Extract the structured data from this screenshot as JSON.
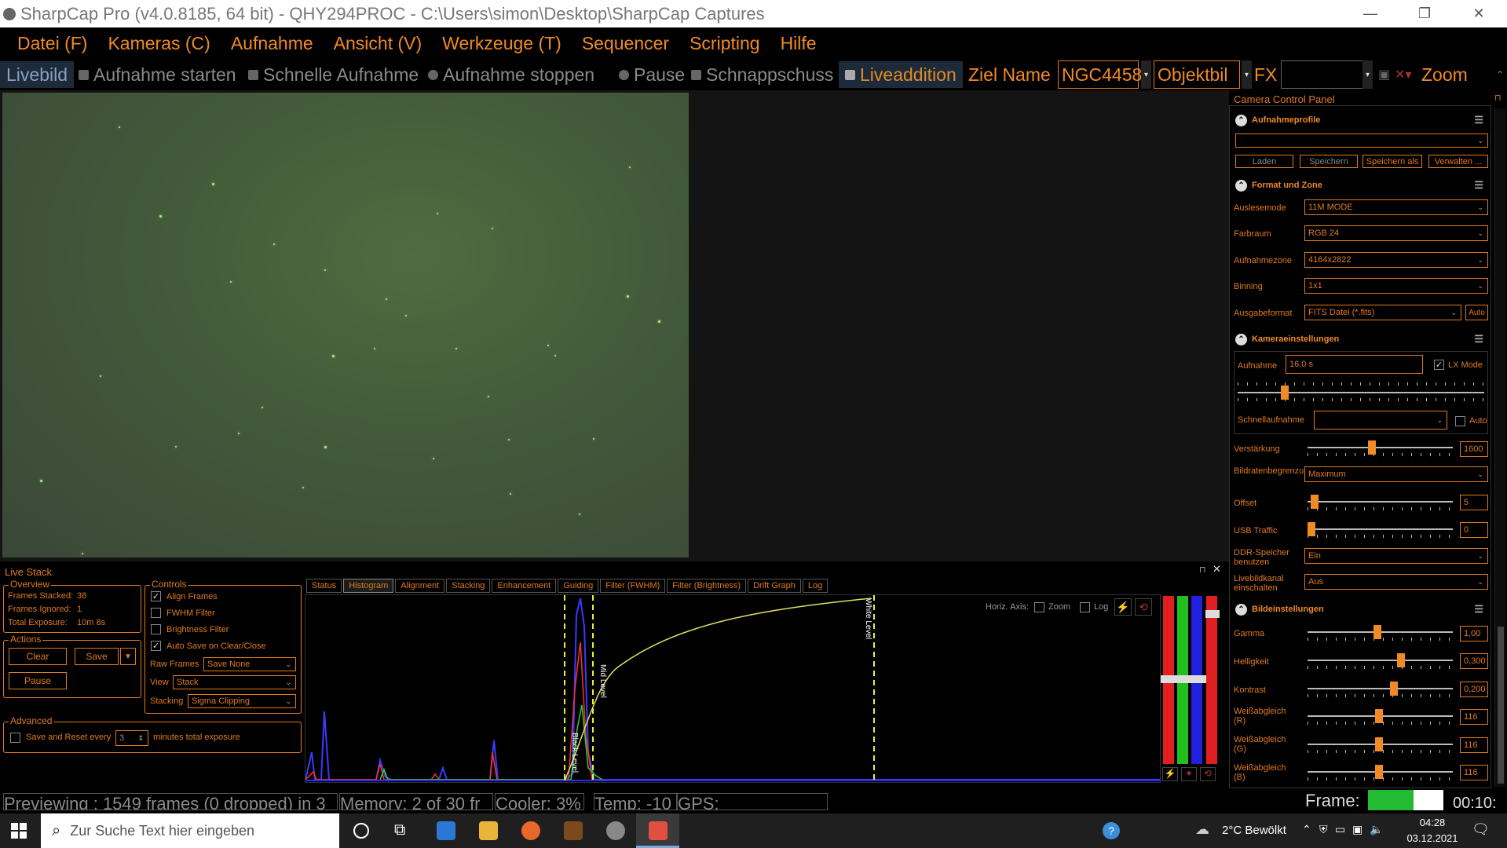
{
  "window": {
    "title": "SharpCap Pro (v4.0.8185, 64 bit) - QHY294PROC - C:\\Users\\simon\\Desktop\\SharpCap Captures",
    "minimize": "—",
    "restore": "❐",
    "close": "✕"
  },
  "menu": [
    "Datei (F)",
    "Kameras (C)",
    "Aufnahme",
    "Ansicht (V)",
    "Werkzeuge (T)",
    "Sequencer",
    "Scripting",
    "Hilfe"
  ],
  "toolbar": {
    "livebild": "Livebild",
    "start": "Aufnahme starten",
    "quick": "Schnelle Aufnahme",
    "stop": "Aufnahme stoppen",
    "pause": "Pause",
    "snapshot": "Schnappschuss",
    "livestack": "Liveaddition",
    "target_label": "Ziel Name",
    "target_value": "NGC4458",
    "object_type": "Objektbil",
    "fx": "FX",
    "zoom": "Zoom"
  },
  "livestack": {
    "title": "Live Stack",
    "overview_title": "Overview",
    "frames_stacked_label": "Frames Stacked:",
    "frames_stacked": "38",
    "frames_ignored_label": "Frames Ignored:",
    "frames_ignored": "1",
    "total_exposure_label": "Total Exposure:",
    "total_exposure": "10m 8s",
    "actions_title": "Actions",
    "clear": "Clear",
    "save": "Save",
    "pause": "Pause",
    "advanced_title": "Advanced",
    "save_reset": "Save and Reset every",
    "save_reset_value": "3",
    "save_reset_suffix": "minutes total exposure",
    "controls_title": "Controls",
    "align_frames": "Align Frames",
    "fwhm_filter": "FWHM Filter",
    "brightness_filter": "Brightness Filter",
    "auto_save": "Auto Save on Clear/Close",
    "raw_frames_label": "Raw Frames",
    "raw_frames": "Save None",
    "view_label": "View",
    "view": "Stack",
    "stacking_label": "Stacking",
    "stacking": "Sigma Clipping",
    "tabs": [
      "Status",
      "Histogram",
      "Alignment",
      "Stacking",
      "Enhancement",
      "Guiding",
      "Filter (FWHM)",
      "Filter (Brightness)",
      "Drift Graph",
      "Log"
    ],
    "horiz_axis": "Horiz. Axis:",
    "zoom": "Zoom",
    "log": "Log",
    "black_level": "Black Level",
    "mid_level": "Mid Level",
    "white_level": "White Level"
  },
  "ccp": {
    "title": "Camera Control Panel",
    "profiles_title": "Aufnahmeprofile",
    "profile_value": "",
    "load": "Laden",
    "save": "Speichern",
    "save_as": "Speichern als",
    "manage": "Verwalten ...",
    "format_title": "Format und Zone",
    "readmode_label": "Auslesemode",
    "readmode": "11M MODE",
    "colorspace_label": "Farbraum",
    "colorspace": "RGB 24",
    "roi_label": "Aufnahmezone",
    "roi": "4164x2822",
    "binning_label": "Binning",
    "binning": "1x1",
    "output_label": "Ausgabeformat",
    "output": "FITS Datei (*.fits)",
    "auto": "Auto",
    "camera_title": "Kameraeinstellungen",
    "exposure_label": "Aufnahme",
    "exposure": "16,0 s",
    "lx_mode": "LX Mode",
    "quick_label": "Schnellaufnahme",
    "quick_auto": "Auto",
    "gain_label": "Verstärkung",
    "gain": "1600",
    "framerate_label": "Bildratenbegrenzung",
    "framerate": "Maximum",
    "offset_label": "Offset",
    "offset": "5",
    "usb_label": "USB Traffic",
    "usb": "0",
    "ddr_label": "DDR-Speicher benutzen",
    "ddr": "Ein",
    "livechannel_label": "Livebildkanal einschalten",
    "livechannel": "Aus",
    "image_title": "Bildeinstellungen",
    "gamma_label": "Gamma",
    "gamma": "1,00",
    "brightness_label": "Helligkeit",
    "brightness": "0,300",
    "contrast_label": "Kontrast",
    "contrast": "0,200",
    "wb_r_label": "Weißabgleich (R)",
    "wb_r": "116",
    "wb_g_label": "Weißabgleich (G)",
    "wb_g": "116",
    "wb_b_label": "Weißabgleich (B)",
    "wb_b": "116"
  },
  "levels": {
    "exposure": 0.18,
    "gain": 0.44,
    "offset": 0.02,
    "usb": 0.0,
    "gamma": 0.48,
    "brightness": 0.65,
    "contrast": 0.6,
    "wb_r": 0.49,
    "wb_g": 0.49,
    "wb_b": 0.49
  },
  "status": {
    "preview": "Previewing : 1549 frames (0 dropped) in 3",
    "memory": "Memory: 2 of 30 fr",
    "cooler": "Cooler: 3%",
    "temp": "Temp: -10",
    "gps": "GPS:",
    "frame_label": "Frame:",
    "time": "00:10:"
  },
  "taskbar": {
    "search_placeholder": "Zur Suche Text hier eingeben",
    "weather": "2°C  Bewölkt",
    "clock_time": "04:28",
    "clock_date": "03.12.2021"
  }
}
